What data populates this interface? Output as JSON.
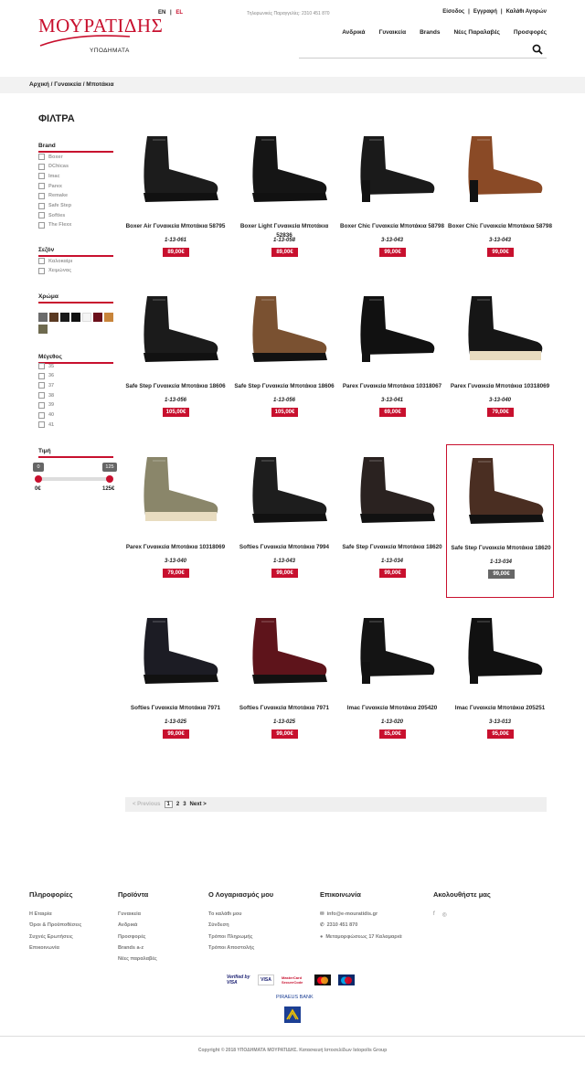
{
  "header": {
    "logo_text": "ΜΟΥΡΑΤΙΔΗΣ",
    "logo_sub": "ΥΠΟΔΗΜΑΤΑ",
    "lang_en": "EN",
    "lang_sep": "|",
    "lang_el": "EL",
    "phone": "Τηλεφωνικές Παραγγελίες: 2310 451 870",
    "user_links": [
      "Είσοδος",
      "Εγγραφή",
      "Καλάθι Αγορών"
    ],
    "nav": [
      "Ανδρικά",
      "Γυναικεία",
      "Brands",
      "Νέες Παραλαβές",
      "Προσφορές"
    ],
    "search_placeholder": ""
  },
  "breadcrumb": "Αρχική / Γυναικεία / Μποτάκια",
  "filters": {
    "title": "ΦΙΛΤΡΑ",
    "brand_label": "Brand",
    "brands": [
      "Boxer",
      "DChicas",
      "Imac",
      "Parex",
      "Remake",
      "Safe Step",
      "Softies",
      "The Flexx"
    ],
    "season_label": "Σεζόν",
    "seasons": [
      "Καλοκαίρι",
      "Χειμώνας"
    ],
    "color_label": "Χρώμα",
    "colors": [
      "#6b6b6b",
      "#5a3a22",
      "#1a1a1a",
      "#111111",
      "#f5f5f5",
      "#6b0f1a",
      "#c8843a",
      "#6e6a4f"
    ],
    "size_label": "Μέγεθος",
    "sizes": [
      "35",
      "36",
      "37",
      "38",
      "39",
      "40",
      "41"
    ],
    "price_label": "Τιμή",
    "price_min_box": "0",
    "price_max_box": "125",
    "price_min": "0€",
    "price_max": "125€"
  },
  "products": [
    {
      "name": "Boxer Air Γυναικεία Μποτάκια 58795",
      "code": "1-13-061",
      "price": "89,00€"
    },
    {
      "name": "Boxer Light Γυναικεία Μποτάκια 52836",
      "code": "1-13-058",
      "price": "89,00€"
    },
    {
      "name": "Boxer Chic Γυναικεία Μποτάκια 58798",
      "code": "3-13-043",
      "price": "99,00€"
    },
    {
      "name": "Boxer Chic Γυναικεία Μποτάκια 58798",
      "code": "3-13-043",
      "price": "99,00€"
    },
    {
      "name": "Safe Step Γυναικεία Μποτάκια 18606",
      "code": "1-13-056",
      "price": "105,00€"
    },
    {
      "name": "Safe Step Γυναικεία Μποτάκια 18606",
      "code": "1-13-056",
      "price": "105,00€"
    },
    {
      "name": "Parex Γυναικεία Μποτάκια 10318067",
      "code": "3-13-041",
      "price": "69,00€"
    },
    {
      "name": "Parex Γυναικεία Μποτάκια 10318069",
      "code": "3-13-040",
      "price": "79,00€"
    },
    {
      "name": "Parex Γυναικεία Μποτάκια 10318069",
      "code": "3-13-040",
      "price": "79,00€"
    },
    {
      "name": "Softies Γυναικεία Μποτάκια 7994",
      "code": "1-13-043",
      "price": "99,00€"
    },
    {
      "name": "Safe Step Γυναικεία Μποτάκια 18620",
      "code": "1-13-034",
      "price": "99,00€"
    },
    {
      "name": "Safe Step Γυναικεία Μποτάκια 18620",
      "code": "1-13-034",
      "price": "99,00€"
    },
    {
      "name": "Softies Γυναικεία Μποτάκια 7971",
      "code": "1-13-025",
      "price": "99,00€"
    },
    {
      "name": "Softies Γυναικεία Μποτάκια 7971",
      "code": "1-13-025",
      "price": "99,00€"
    },
    {
      "name": "Imac Γυναικεία Μποτάκια 205420",
      "code": "1-13-020",
      "price": "85,00€"
    },
    {
      "name": "Imac Γυναικεία Μποτάκια 205251",
      "code": "3-13-013",
      "price": "95,00€"
    }
  ],
  "pagination": {
    "prev": "< Previous",
    "pages": [
      "1",
      "2",
      "3"
    ],
    "next": "Next >"
  },
  "footer": {
    "info_title": "Πληροφορίες",
    "info_links": [
      "Η Εταιρία",
      "Όροι & Προϋποθέσεις",
      "Συχνές Ερωτήσεις",
      "Επικοινωνία"
    ],
    "products_title": "Προϊόντα",
    "products_links": [
      "Γυναικεία",
      "Ανδρικά",
      "Προσφορές",
      "Brands a-z",
      "Νέες παραλαβές"
    ],
    "account_title": "Ο Λογαριασμός μου",
    "account_links": [
      "Το καλάθι μου",
      "Σύνδεση",
      "Τρόποι Πληρωμής",
      "Τρόποι Αποστολής"
    ],
    "contact_title": "Επικοινωνία",
    "contact_email": "info@e-mouratidis.gr",
    "contact_phone": "2310 451 870",
    "contact_address": "Μεταμορφώσεως 17 Καλαμαριά",
    "follow_title": "Ακολουθήστε μας",
    "social_fb": "f",
    "social_ig": "◎",
    "payment_logos": [
      "Verified by VISA",
      "VISA",
      "MasterCard SecureCode",
      "",
      ""
    ],
    "bank": "PIRAEUS BANK",
    "copyright": "Copyright © 2018 ΥΠΟΔΗΜΑΤΑ ΜΟΥΡΑΤΙΔΗΣ. Κατασκευή Ιστοσελίδων Istopolis Group"
  }
}
